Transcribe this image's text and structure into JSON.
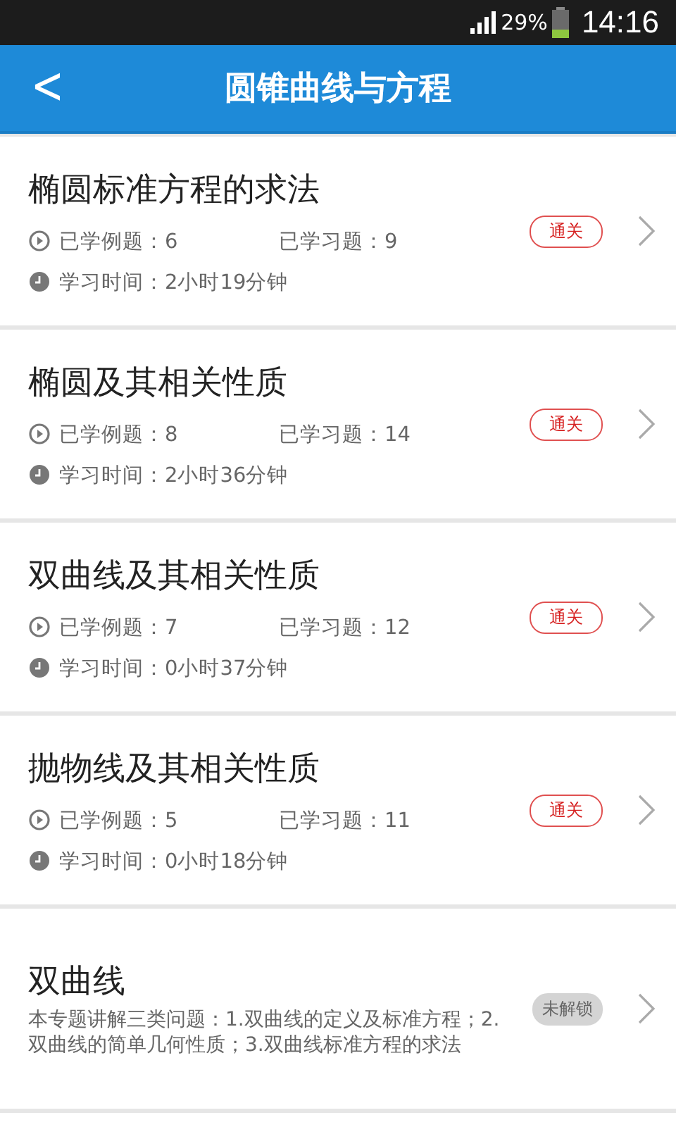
{
  "status_bar": {
    "battery": "29%",
    "time": "14:16"
  },
  "header": {
    "back": "<",
    "title": "圆锥曲线与方程"
  },
  "topics": [
    {
      "kind": "progress",
      "title": "椭圆标准方程的求法",
      "examples": "已学例题：6",
      "exercises": "已学习题：9",
      "time": "学习时间：2小时19分钟",
      "badge": "通关",
      "locked": false
    },
    {
      "kind": "progress",
      "title": "椭圆及其相关性质",
      "examples": "已学例题：8",
      "exercises": "已学习题：14",
      "time": "学习时间：2小时36分钟",
      "badge": "通关",
      "locked": false
    },
    {
      "kind": "progress",
      "title": "双曲线及其相关性质",
      "examples": "已学例题：7",
      "exercises": "已学习题：12",
      "time": "学习时间：0小时37分钟",
      "badge": "通关",
      "locked": false
    },
    {
      "kind": "progress",
      "title": "抛物线及其相关性质",
      "examples": "已学例题：5",
      "exercises": "已学习题：11",
      "time": "学习时间：0小时18分钟",
      "badge": "通关",
      "locked": false
    },
    {
      "kind": "description",
      "title": "双曲线",
      "description": "本专题讲解三类问题：1.双曲线的定义及标准方程；2.双曲线的简单几何性质；3.双曲线标准方程的求法",
      "badge": "未解锁",
      "locked": true
    }
  ]
}
